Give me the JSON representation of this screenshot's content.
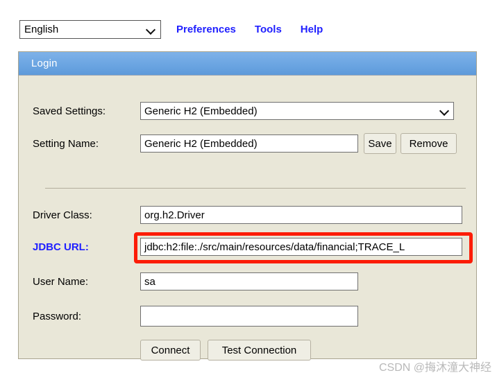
{
  "toolbar": {
    "language_select": {
      "value": "English",
      "icon": "chevron-down-icon"
    },
    "links": [
      {
        "label": "Preferences"
      },
      {
        "label": "Tools"
      },
      {
        "label": "Help"
      }
    ]
  },
  "login_panel": {
    "title": "Login",
    "saved_settings": {
      "label": "Saved Settings:",
      "value": "Generic H2 (Embedded)",
      "icon": "chevron-down-icon"
    },
    "setting_name": {
      "label": "Setting Name:",
      "value": "Generic H2 (Embedded)",
      "save_label": "Save",
      "remove_label": "Remove"
    },
    "driver_class": {
      "label": "Driver Class:",
      "value": "org.h2.Driver"
    },
    "jdbc_url": {
      "label": "JDBC URL:",
      "value": "jdbc:h2:file:./src/main/resources/data/financial;TRACE_L",
      "highlighted": true,
      "highlight_color": "#fc1c06"
    },
    "user_name": {
      "label": "User Name:",
      "value": "sa"
    },
    "password": {
      "label": "Password:",
      "value": ""
    },
    "actions": {
      "connect_label": "Connect",
      "test_connection_label": "Test Connection"
    }
  },
  "watermark": {
    "text": "CSDN @挴沐潼大神经"
  },
  "colors": {
    "header_gradient_top": "#7fb2e8",
    "header_gradient_bottom": "#5e9ada",
    "panel_background": "#e9e7d8",
    "link_blue": "#2020ff",
    "highlight_red": "#fc1c06"
  }
}
